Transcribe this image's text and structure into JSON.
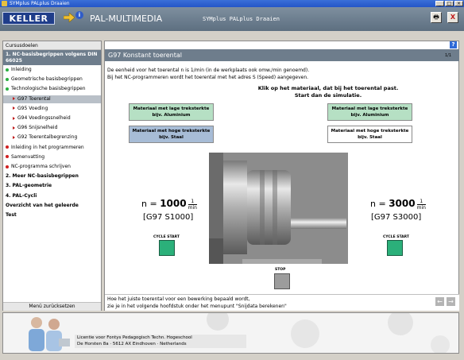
{
  "window": {
    "title": "SYMplus PALplus Draaien",
    "controls": [
      "_",
      "□",
      "×"
    ]
  },
  "header": {
    "logo": "KELLER",
    "app_name": "PAL-MULTIMEDIA",
    "course_title": "SYMplus PALplus Draaien",
    "buttons": {
      "print": "🖶",
      "close": "X"
    }
  },
  "sidebar": {
    "heading": "Cursusdoelen",
    "selected_chapter": "1. NC-basisbegrippen volgens DIN 66025",
    "items": [
      {
        "label": "Inleiding",
        "kind": "bullet",
        "color": "#2bb040"
      },
      {
        "label": "Geometrische basisbegrippen",
        "kind": "bullet",
        "color": "#2bb040"
      },
      {
        "label": "Technologische basisbegrippen",
        "kind": "bullet",
        "color": "#2bb040"
      },
      {
        "label": "G97 Toerental",
        "kind": "tri",
        "active": true
      },
      {
        "label": "G95 Voeding",
        "kind": "tri"
      },
      {
        "label": "G94 Voedingssnelheid",
        "kind": "tri"
      },
      {
        "label": "G96 Snijsnelheid",
        "kind": "tri"
      },
      {
        "label": "G92 Toerentalbegrenzing",
        "kind": "tri"
      },
      {
        "label": "Inleiding in het programmeren",
        "kind": "bullet",
        "color": "#d02020"
      },
      {
        "label": "Samenvatting",
        "kind": "bullet",
        "color": "#d02020"
      },
      {
        "label": "NC-programma schrijven",
        "kind": "bullet",
        "color": "#d02020"
      },
      {
        "label": "2. Meer NC-basisbegrippen",
        "kind": "chapter"
      },
      {
        "label": "3. PAL-geometrie",
        "kind": "chapter"
      },
      {
        "label": "4. PAL-Cycli",
        "kind": "chapter"
      },
      {
        "label": "Overzicht van het geleerde",
        "kind": "chapter"
      },
      {
        "label": "Test",
        "kind": "chapter"
      }
    ],
    "footer": "Menü zurücksetzen"
  },
  "main": {
    "help": "?",
    "title": "G97 Konstant toerental",
    "page": "1/1",
    "intro": [
      "De eenheid voor het toerental n is 1/min (in de werkplaats ook omw./min genoemd).",
      "Bij het NC-programmeren wordt het toerental met het adres S (Speed) aangegeven."
    ],
    "instruction": [
      "Klik op het materiaal, dat bij het toerental past.",
      "Start dan de simulatie."
    ],
    "left_buttons": [
      {
        "line1": "Materiaal met lage treksterkte",
        "line2": "bijv. Aluminium"
      },
      {
        "line1": "Materiaal met hoge treksterkte",
        "line2": "bijv. Staal"
      }
    ],
    "right_buttons": [
      {
        "line1": "Materiaal met lage treksterkte",
        "line2": "bijv. Aluminium"
      },
      {
        "line1": "Materiaal met hoge treksterkte",
        "line2": "bijv. Staal"
      }
    ],
    "left_formula": {
      "prefix": "n = ",
      "value": "1000",
      "num": "1",
      "den": "min",
      "gcode": "[G97 S1000]"
    },
    "right_formula": {
      "prefix": "n = ",
      "value": "3000",
      "num": "1",
      "den": "min",
      "gcode": "[G97 S3000]"
    },
    "cycle_start": "CYCLE START",
    "stop": "STOP",
    "footer_text": [
      "Hoe het juiste toerental voor een bewerking bepaald wordt,",
      "zie je in het volgende hoofdstuk onder het menupunt \"Snijdata berekenen\""
    ],
    "nav": {
      "prev": "←",
      "next": "→"
    }
  },
  "license": {
    "line1": "Licentie voor Fontys Pedagogisch Techn. Hogeschool",
    "line2": "De Horsten 8a · 5612 AX Eindhoven · Netherlands"
  },
  "colors": {
    "header": "#6e7d8c",
    "green_button": "#b6e0c4",
    "blue_button": "#a7bcd6",
    "cycle_start": "#2bb07a"
  }
}
